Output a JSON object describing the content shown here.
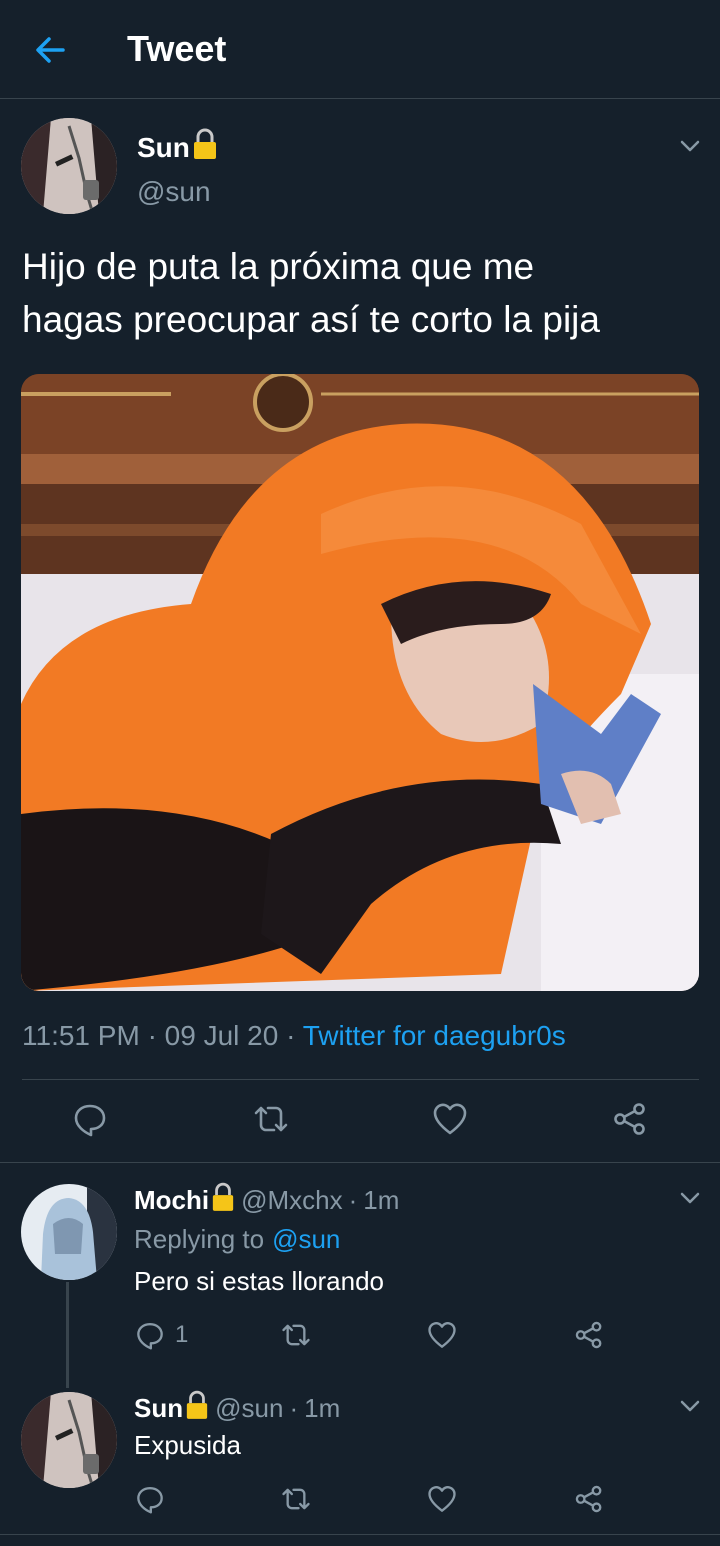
{
  "header": {
    "title": "Tweet"
  },
  "tweet": {
    "author_name": "Sun",
    "author_handle": "@sun",
    "text_line1": "Hijo de puta la próxima que me",
    "text_line2": "hagas preocupar así te corto la pija",
    "time": "11:51 PM",
    "date": "09 Jul 20",
    "source": "Twitter for daegubr0s",
    "sep": "·"
  },
  "replies": [
    {
      "name": "Mochi",
      "handle": "@Mxchx",
      "time": "1m",
      "replying_prefix": "Replying to",
      "replying_to": "@sun",
      "text": "Pero si estas llorando",
      "reply_count": "1"
    },
    {
      "name": "Sun",
      "handle": "@sun",
      "time": "1m",
      "text": "Expusida"
    }
  ],
  "icons": {
    "back": "arrow-left-icon",
    "lock": "lock-icon",
    "chevron": "chevron-down-icon",
    "reply": "reply-icon",
    "retweet": "retweet-icon",
    "like": "heart-icon",
    "share": "share-icon"
  },
  "colors": {
    "background": "#15202b",
    "accent": "#1da1f2",
    "muted": "#8899a6",
    "border": "#38444d",
    "lock": "#f5c518"
  }
}
